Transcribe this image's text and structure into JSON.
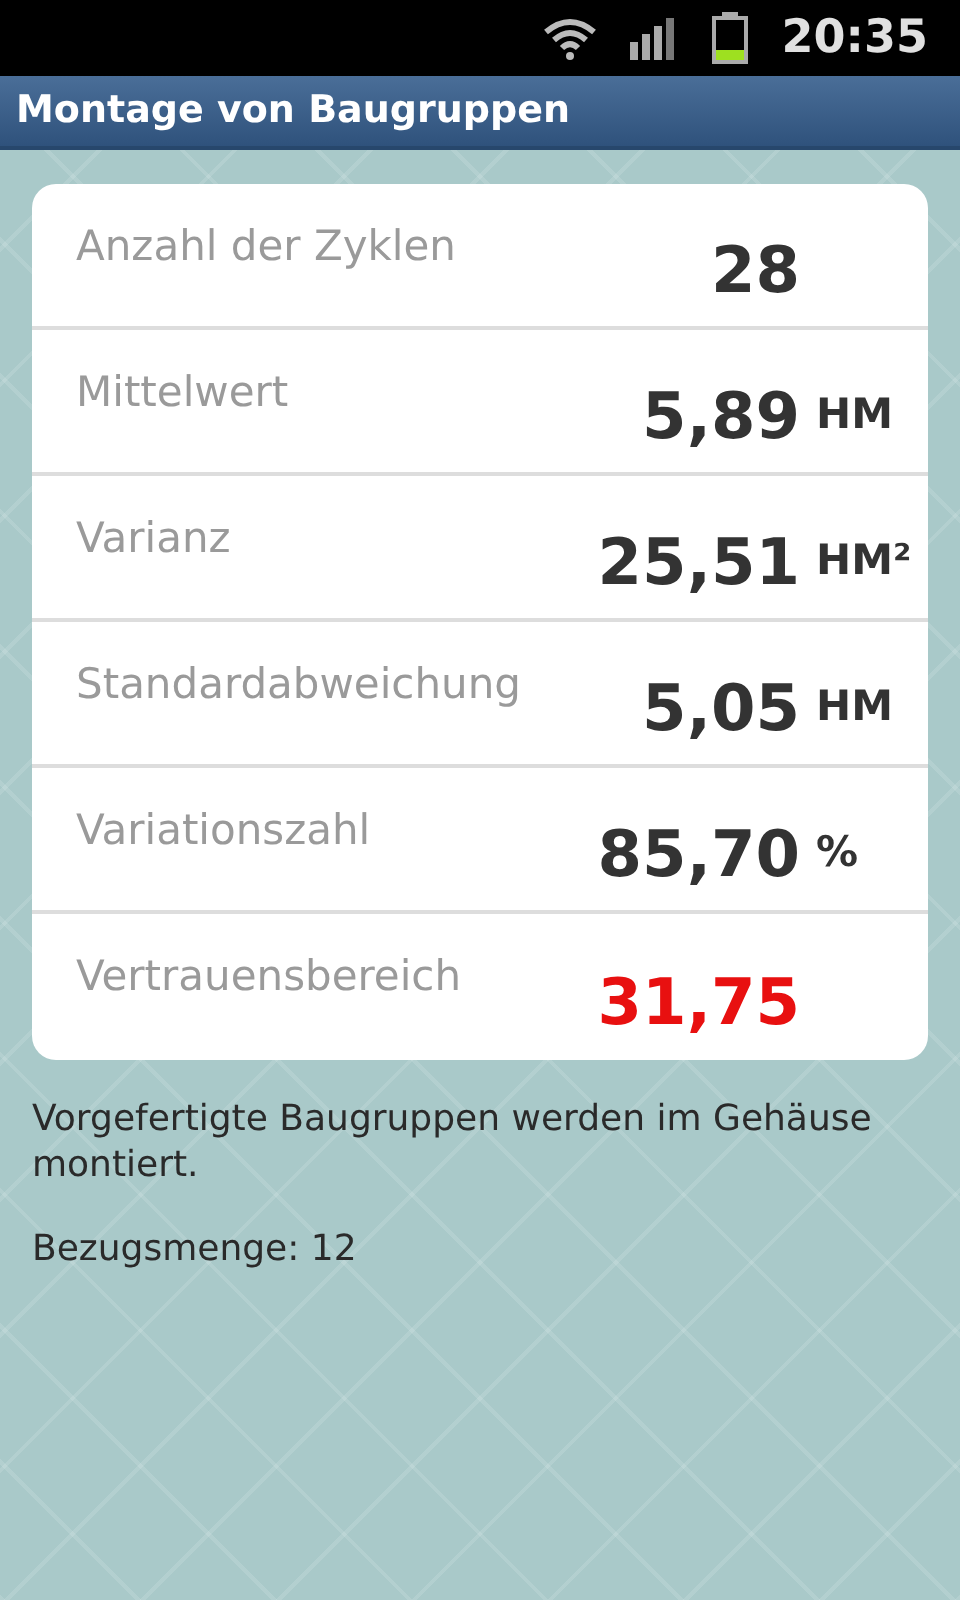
{
  "status_bar": {
    "time": "20:35"
  },
  "title": "Montage von Baugruppen",
  "stats": [
    {
      "label": "Anzahl der Zyklen",
      "value": "28",
      "highlighted": false
    },
    {
      "label": "Mittelwert",
      "value": "5,89",
      "unit": "HM",
      "highlighted": false
    },
    {
      "label": "Varianz",
      "value": "25,51",
      "unit": "HM²",
      "highlighted": false
    },
    {
      "label": "Standardabweichung",
      "value": "5,05",
      "unit": "HM",
      "highlighted": false
    },
    {
      "label": "Variationszahl",
      "value": "85,70",
      "unit": "%",
      "highlighted": false
    },
    {
      "label": "Vertrauensbereich",
      "value": "31,75",
      "highlighted": true
    }
  ],
  "description": "Vorgefertigte Baugruppen werden im Gehäuse montiert.",
  "reference": "Bezugsmenge: 12"
}
